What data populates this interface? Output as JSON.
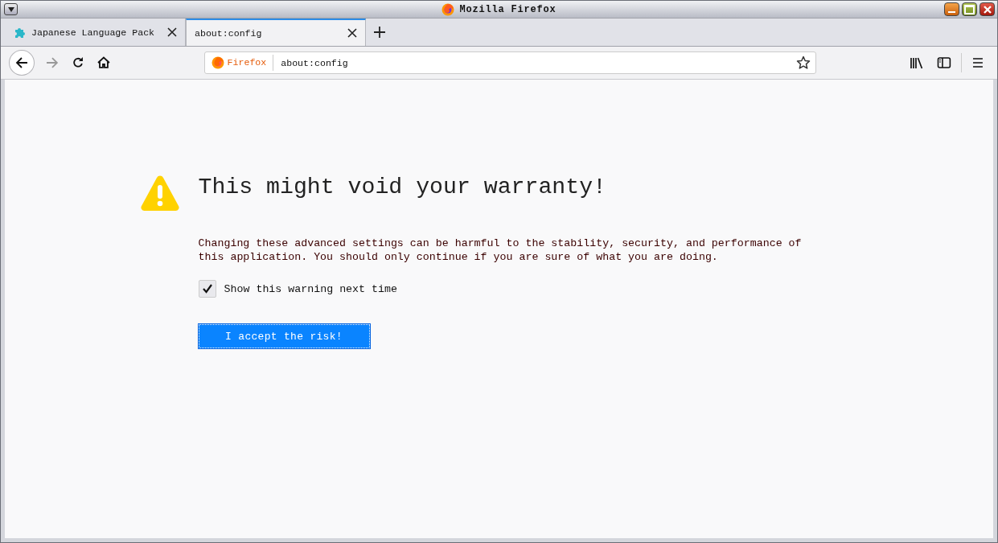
{
  "window": {
    "title": "Mozilla Firefox"
  },
  "tabs": [
    {
      "label": "Japanese Language Pack",
      "selected": false
    },
    {
      "label": "about:config",
      "selected": true
    }
  ],
  "address_bar": {
    "identity": "Firefox",
    "value": "about:config"
  },
  "page": {
    "heading": "This might void your warranty!",
    "message": "Changing these advanced settings can be harmful to the stability, security, and performance of this application. You should only continue if you are sure of what you are doing.",
    "checkbox": {
      "label": "Show this warning next time",
      "checked": true
    },
    "button": "I accept the risk!"
  }
}
